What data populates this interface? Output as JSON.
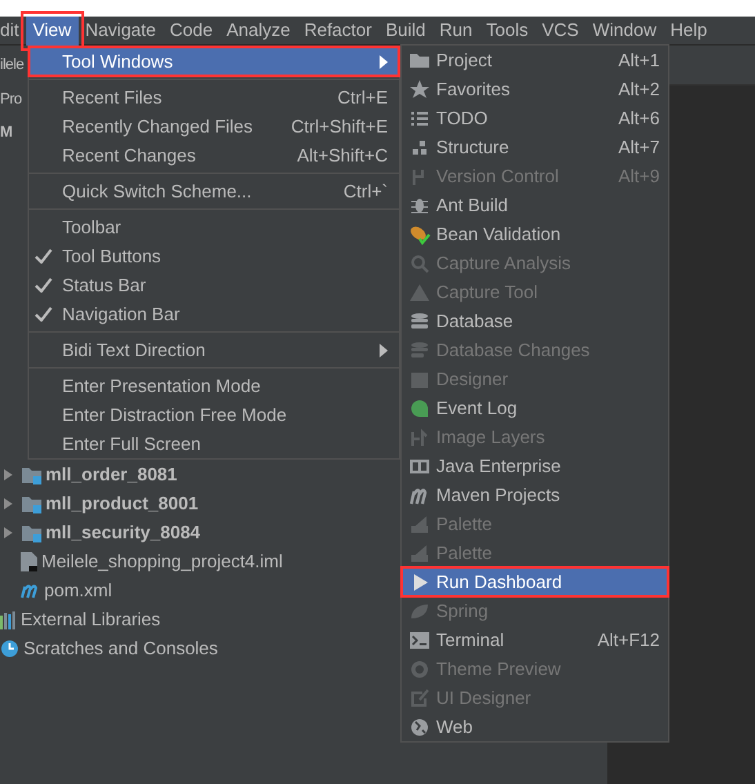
{
  "menubar": [
    {
      "label": "dit",
      "selected": false,
      "annotated": false
    },
    {
      "label": "View",
      "selected": true,
      "annotated": true
    },
    {
      "label": "Navigate",
      "selected": false,
      "annotated": false
    },
    {
      "label": "Code",
      "selected": false,
      "annotated": false
    },
    {
      "label": "Analyze",
      "selected": false,
      "annotated": false
    },
    {
      "label": "Refactor",
      "selected": false,
      "annotated": false
    },
    {
      "label": "Build",
      "selected": false,
      "annotated": false
    },
    {
      "label": "Run",
      "selected": false,
      "annotated": false
    },
    {
      "label": "Tools",
      "selected": false,
      "annotated": false
    },
    {
      "label": "VCS",
      "selected": false,
      "annotated": false
    },
    {
      "label": "Window",
      "selected": false,
      "annotated": false
    },
    {
      "label": "Help",
      "selected": false,
      "annotated": false
    }
  ],
  "background_fragments": [
    "ilele",
    "Pro",
    "M"
  ],
  "project_tree": [
    {
      "kind": "module",
      "label": "mll_order_8081",
      "expanded": false
    },
    {
      "kind": "module",
      "label": "mll_product_8001",
      "expanded": false
    },
    {
      "kind": "module",
      "label": "mll_security_8084",
      "expanded": false
    },
    {
      "kind": "iml",
      "label": "Meilele_shopping_project4.iml"
    },
    {
      "kind": "pom",
      "label": "pom.xml"
    },
    {
      "kind": "libraries",
      "label": "External Libraries"
    },
    {
      "kind": "scratches",
      "label": "Scratches and Consoles"
    }
  ],
  "view_menu": [
    [
      {
        "label": "Tool Windows",
        "submenu": true,
        "selected": true,
        "annotated": true
      }
    ],
    [
      {
        "label": "Recent Files",
        "shortcut": "Ctrl+E",
        "selected": false
      },
      {
        "label": "Recently Changed Files",
        "shortcut": "Ctrl+Shift+E",
        "selected": false
      },
      {
        "label": "Recent Changes",
        "shortcut": "Alt+Shift+C",
        "selected": false
      }
    ],
    [
      {
        "label": "Quick Switch Scheme...",
        "shortcut": "Ctrl+`",
        "selected": false
      }
    ],
    [
      {
        "label": "Toolbar",
        "checked": false,
        "selected": false
      },
      {
        "label": "Tool Buttons",
        "checked": true,
        "selected": false
      },
      {
        "label": "Status Bar",
        "checked": true,
        "selected": false
      },
      {
        "label": "Navigation Bar",
        "checked": true,
        "selected": false
      }
    ],
    [
      {
        "label": "Bidi Text Direction",
        "submenu": true,
        "selected": false
      }
    ],
    [
      {
        "label": "Enter Presentation Mode",
        "selected": false
      },
      {
        "label": "Enter Distraction Free Mode",
        "selected": false
      },
      {
        "label": "Enter Full Screen",
        "selected": false
      }
    ]
  ],
  "tool_windows_menu": [
    {
      "label": "Project",
      "shortcut": "Alt+1",
      "disabled": false,
      "selected": false,
      "annotated": false
    },
    {
      "label": "Favorites",
      "shortcut": "Alt+2",
      "disabled": false,
      "selected": false,
      "annotated": false
    },
    {
      "label": "TODO",
      "shortcut": "Alt+6",
      "disabled": false,
      "selected": false,
      "annotated": false
    },
    {
      "label": "Structure",
      "shortcut": "Alt+7",
      "disabled": false,
      "selected": false,
      "annotated": false
    },
    {
      "label": "Version Control",
      "shortcut": "Alt+9",
      "disabled": true,
      "selected": false,
      "annotated": false
    },
    {
      "label": "Ant Build",
      "disabled": false,
      "selected": false,
      "annotated": false
    },
    {
      "label": "Bean Validation",
      "disabled": false,
      "selected": false,
      "annotated": false
    },
    {
      "label": "Capture Analysis",
      "disabled": true,
      "selected": false,
      "annotated": false
    },
    {
      "label": "Capture Tool",
      "disabled": true,
      "selected": false,
      "annotated": false
    },
    {
      "label": "Database",
      "disabled": false,
      "selected": false,
      "annotated": false
    },
    {
      "label": "Database Changes",
      "disabled": true,
      "selected": false,
      "annotated": false
    },
    {
      "label": "Designer",
      "disabled": true,
      "selected": false,
      "annotated": false
    },
    {
      "label": "Event Log",
      "disabled": false,
      "selected": false,
      "annotated": false
    },
    {
      "label": "Image Layers",
      "disabled": true,
      "selected": false,
      "annotated": false
    },
    {
      "label": "Java Enterprise",
      "disabled": false,
      "selected": false,
      "annotated": false
    },
    {
      "label": "Maven Projects",
      "disabled": false,
      "selected": false,
      "annotated": false
    },
    {
      "label": "Palette",
      "disabled": true,
      "selected": false,
      "annotated": false
    },
    {
      "label": "Palette",
      "disabled": true,
      "selected": false,
      "annotated": false
    },
    {
      "label": "Run Dashboard",
      "disabled": false,
      "selected": true,
      "annotated": true
    },
    {
      "label": "Spring",
      "disabled": true,
      "selected": false,
      "annotated": false
    },
    {
      "label": "Terminal",
      "shortcut": "Alt+F12",
      "disabled": false,
      "selected": false,
      "annotated": false
    },
    {
      "label": "Theme Preview",
      "disabled": true,
      "selected": false,
      "annotated": false
    },
    {
      "label": "UI Designer",
      "disabled": true,
      "selected": false,
      "annotated": false
    },
    {
      "label": "Web",
      "disabled": false,
      "selected": false,
      "annotated": false
    }
  ]
}
